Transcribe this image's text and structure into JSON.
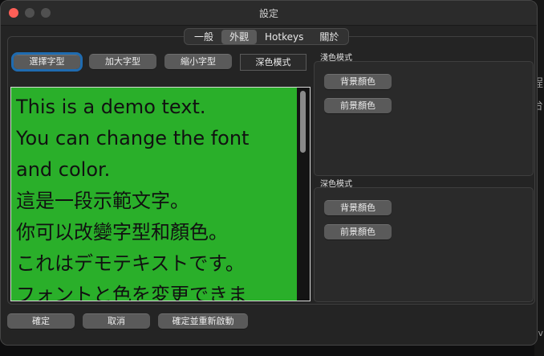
{
  "window": {
    "title": "設定"
  },
  "tabs": [
    {
      "label": "一般",
      "active": false
    },
    {
      "label": "外觀",
      "active": true
    },
    {
      "label": "Hotkeys",
      "active": false
    },
    {
      "label": "關於",
      "active": false
    }
  ],
  "toolbar": {
    "select_font": "選擇字型",
    "bigger_font": "加大字型",
    "smaller_font": "縮小字型",
    "dark_mode": "深色模式"
  },
  "preview": {
    "lines": [
      "This is a demo text.",
      "You can change the font",
      "and color.",
      "這是一段示範文字。",
      "你可以改變字型和顏色。",
      "これはデモテキストです。",
      "フォントと色を変更できま"
    ],
    "background_color": "#2aaf2a",
    "text_color": "#111111"
  },
  "light_mode_group": {
    "title": "淺色模式",
    "background_color_button": "背景顏色",
    "foreground_color_button": "前景顏色"
  },
  "dark_mode_group": {
    "title": "深色模式",
    "background_color_button": "背景顏色",
    "foreground_color_button": "前景顏色"
  },
  "footer": {
    "ok": "確定",
    "cancel": "取消",
    "ok_restart": "確定並重新啟動"
  },
  "background_app_text": [
    "程",
    "台",
    "v"
  ]
}
